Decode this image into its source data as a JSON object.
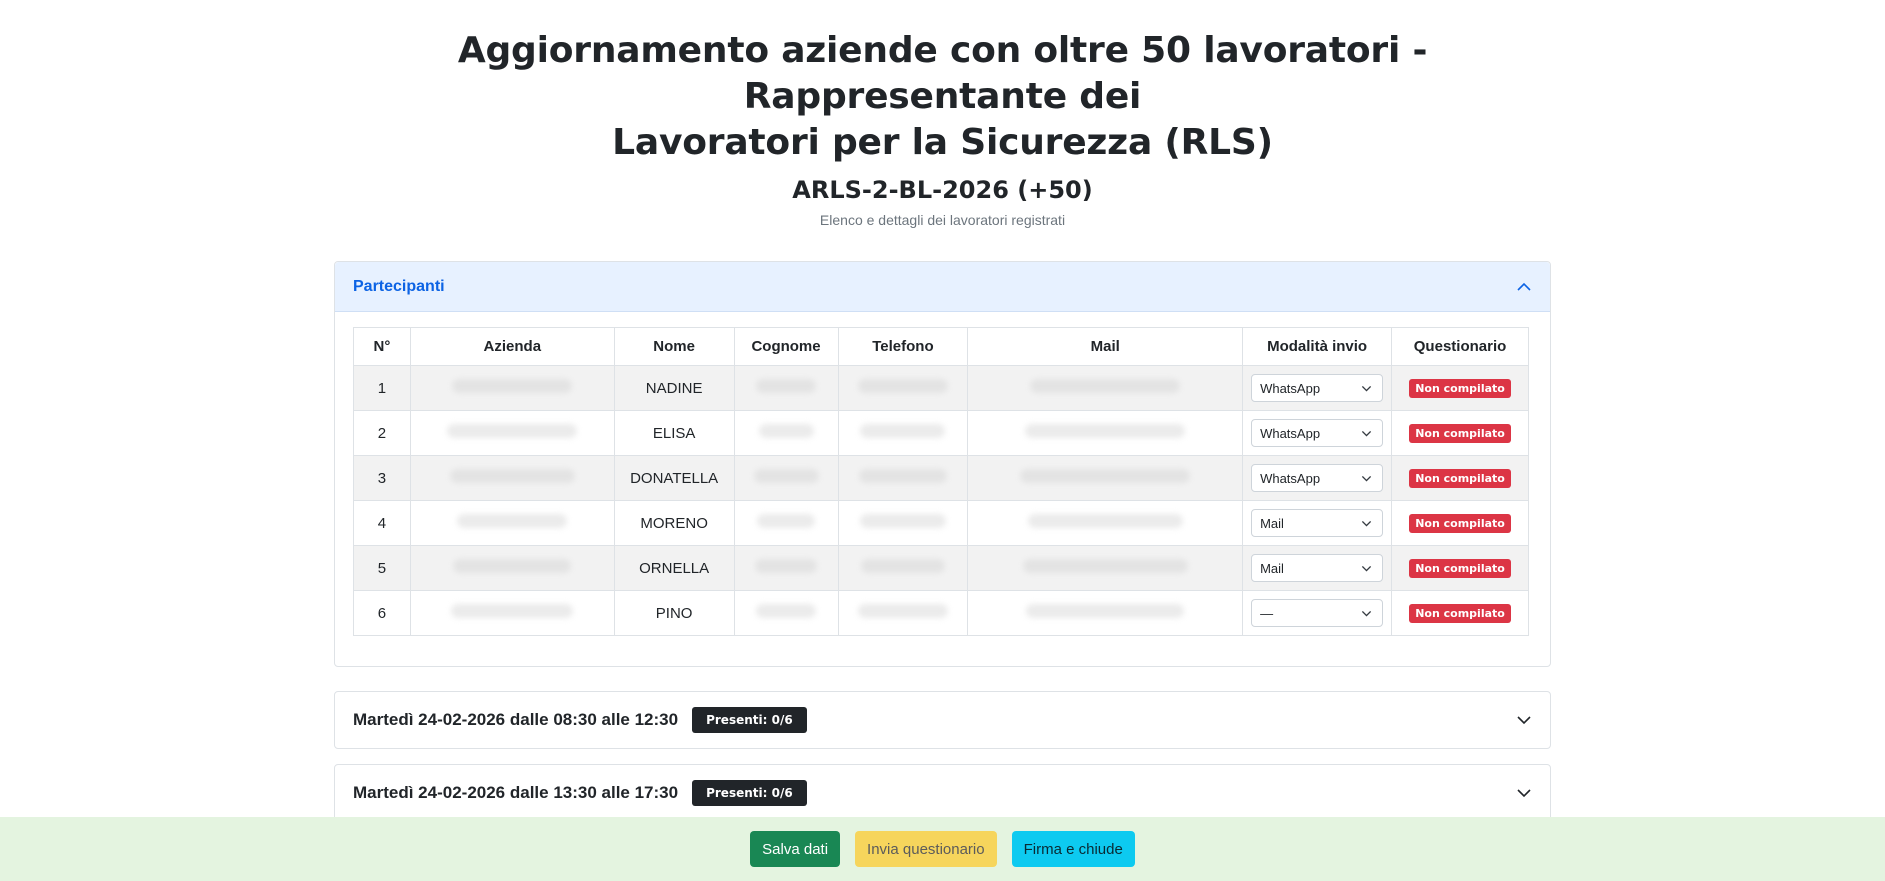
{
  "header": {
    "title_line1": "Aggiornamento aziende con oltre 50 lavoratori - Rappresentante dei",
    "title_line2": "Lavoratori per la Sicurezza (RLS)",
    "code": "ARLS-2-BL-2026 (+50)",
    "subtitle": "Elenco e dettagli dei lavoratori registrati"
  },
  "participants": {
    "title": "Partecipanti",
    "columns": [
      "N°",
      "Azienda",
      "Nome",
      "Cognome",
      "Telefono",
      "Mail",
      "Modalità invio",
      "Questionario"
    ],
    "rows": [
      {
        "n": "1",
        "nome": "NADINE",
        "modalita": "WhatsApp",
        "questionario": "Non compilato"
      },
      {
        "n": "2",
        "nome": "ELISA",
        "modalita": "WhatsApp",
        "questionario": "Non compilato"
      },
      {
        "n": "3",
        "nome": "DONATELLA",
        "modalita": "WhatsApp",
        "questionario": "Non compilato"
      },
      {
        "n": "4",
        "nome": "MORENO",
        "modalita": "Mail",
        "questionario": "Non compilato"
      },
      {
        "n": "5",
        "nome": "ORNELLA",
        "modalita": "Mail",
        "questionario": "Non compilato"
      },
      {
        "n": "6",
        "nome": "PINO",
        "modalita": "—",
        "questionario": "Non compilato"
      }
    ]
  },
  "sessions": [
    {
      "title": "Martedì 24-02-2026 dalle 08:30 alle 12:30",
      "badge": "Presenti: 0/6"
    },
    {
      "title": "Martedì 24-02-2026 dalle 13:30 alle 17:30",
      "badge": "Presenti: 0/6"
    }
  ],
  "footer": {
    "save": "Salva dati",
    "send": "Invia questionario",
    "sign": "Firma e chiude"
  },
  "colors": {
    "accent": "#0c63e4",
    "danger": "#dc3545",
    "success": "#198754",
    "warning": "#f6d55c",
    "info": "#0dcaf0",
    "footer_bg": "#e4f4e0"
  },
  "icons": {
    "accordion_open": "chevron-up-icon",
    "accordion_closed": "chevron-down-icon",
    "select": "chevron-down-icon"
  }
}
